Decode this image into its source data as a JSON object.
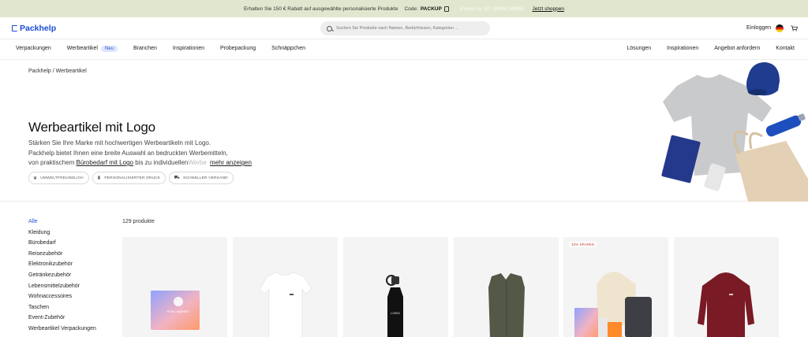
{
  "promo": {
    "text": "Erhalten Sie 150 € Rabatt auf ausgewählte personalisierte Produkte",
    "code_label": "Code:",
    "code": "PACKUP",
    "timer": "Endet in: 6T 09Std 59Min",
    "link": "Jetzt shoppen"
  },
  "header": {
    "logo": "Packhelp",
    "search_placeholder": "Suchen Sie Produkte nach Namen, Bedürfnissen, Kategorien ...",
    "login": "Einloggen"
  },
  "nav": {
    "left": [
      "Verpackungen",
      "Werbeartikel",
      "Branchen",
      "Inspirationen",
      "Probepackung",
      "Schnäppchen"
    ],
    "badge": "Neu",
    "right": [
      "Lösungen",
      "Inspirationen",
      "Angebot anfordern",
      "Kontakt"
    ]
  },
  "hero": {
    "breadcrumb": "Packhelp / Werbeartikel",
    "title": "Werbeartikel mit Logo",
    "desc_line1": "Stärken Sie Ihre Marke mit hochwertigen Werbeartikeln mit Logo.",
    "desc_line2": "Packhelp bietet Ihnen eine breite Auswahl an bedruckten Werbemitteln,",
    "desc_line3_pre": "von praktischem",
    "desc_link": "Bürobedarf mit Logo",
    "desc_line3_post": "bis zu individuellen",
    "desc_fade": "Werbe",
    "more": "mehr anzeigen",
    "chips": [
      "UMWELTFREUNDLICH",
      "PERSONALISIERTER DRUCK",
      "SCHNELLER VERSAND"
    ]
  },
  "products": {
    "count": "129 produkte",
    "categories": [
      "Alle",
      "Kleidung",
      "Bürobedarf",
      "Reisezubehör",
      "Elektronikzubehör",
      "Getränkezubehör",
      "Lebensmittelzubehör",
      "Wohnaccessoires",
      "Taschen",
      "Event-Zubehör",
      "Werbeartikel Verpackungen"
    ],
    "sale_tag": "10% SPAREN",
    "bottle_logo": "LOGO",
    "box_logo": "PIXEL MARKET"
  },
  "colors": {
    "brand": "#1a4bd6",
    "promo_bg": "#e1e7cf",
    "badge_bg": "#dde6ff",
    "sale": "#c0392b"
  }
}
